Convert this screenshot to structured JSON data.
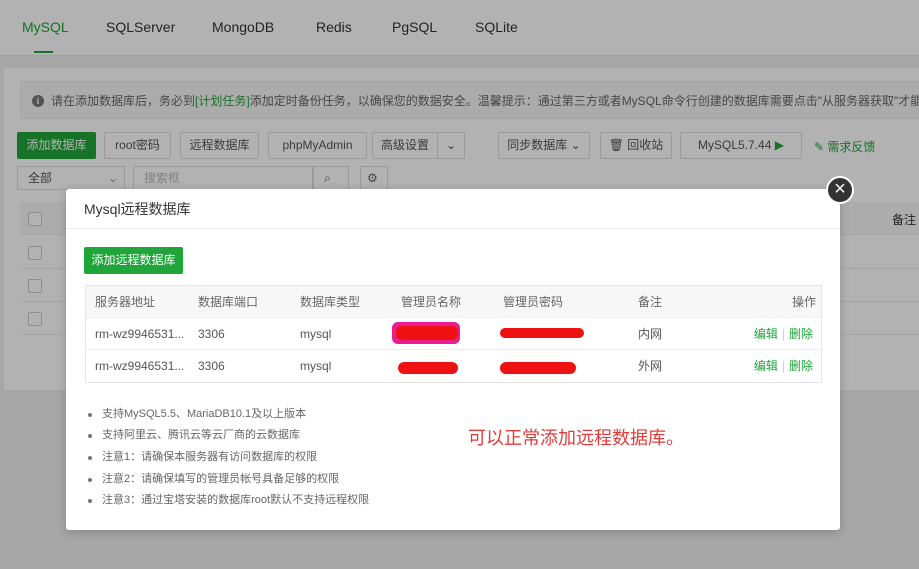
{
  "tabs": [
    "MySQL",
    "SQLServer",
    "MongoDB",
    "Redis",
    "PgSQL",
    "SQLite"
  ],
  "notice": {
    "prefix": "请在添加数据库后，务必到",
    "link": "[计划任务]",
    "suffix": "添加定时备份任务，以确保您的数据安全。温馨提示：通过第三方或者MySQL命令行创建的数据库需要点击\"从服务器获取\"才能在"
  },
  "toolbar": {
    "add_db": "添加数据库",
    "root_pwd": "root密码",
    "remote_db": "远程数据库",
    "phpmyadmin": "phpMyAdmin",
    "advanced": "高级设置",
    "sync_db": "同步数据库",
    "recycle": "回收站",
    "mysql_version": "MySQL5.7.44",
    "feedback": "需求反馈"
  },
  "filter": {
    "select": "全部",
    "search_placeholder": "搜索框"
  },
  "bg_cols": {
    "remark": "备注"
  },
  "modal": {
    "title": "Mysql远程数据库",
    "add_button": "添加远程数据库",
    "headers": [
      "服务器地址",
      "数据库端口",
      "数据库类型",
      "管理员名称",
      "管理员密码",
      "备注",
      "操作"
    ],
    "rows": [
      {
        "host": "rm-wz9946531...",
        "port": "3306",
        "type": "mysql",
        "remark": "内网",
        "edit": "编辑",
        "delete": "删除"
      },
      {
        "host": "rm-wz9946531...",
        "port": "3306",
        "type": "mysql",
        "remark": "外网",
        "edit": "编辑",
        "delete": "删除"
      }
    ],
    "notes": [
      "支持MySQL5.5、MariaDB10.1及以上版本",
      "支持阿里云、腾讯云等云厂商的云数据库",
      "注意1：请确保本服务器有访问数据库的权限",
      "注意2：请确保填写的管理员帐号具备足够的权限",
      "注意3：通过宝塔安装的数据库root默认不支持远程权限"
    ],
    "annotation": "可以正常添加远程数据库。"
  },
  "colors": {
    "accent": "#20a53a",
    "annotation": "#e43a3a",
    "redact": "#ee1111"
  }
}
